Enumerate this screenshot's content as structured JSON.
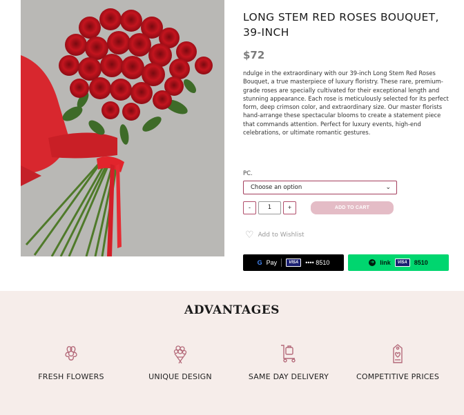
{
  "product": {
    "title": "LONG STEM RED ROSES BOUQUET, 39-INCH",
    "price": "$72",
    "description": "ndulge in the extraordinary with our 39-inch Long Stem Red Roses Bouquet, a true masterpiece of luxury floristry. These rare, premium-grade roses are specially cultivated for their exceptional length and stunning appearance. Each rose is meticulously selected for its perfect form, deep crimson color, and extraordinary size. Our master florists hand-arrange these spectacular blooms to create a statement piece that commands attention.  Perfect for luxury events, high-end celebrations, or ultimate romantic gestures."
  },
  "options": {
    "label": "PC.",
    "select_value": "Choose an option",
    "chevron_icon": "chevron-down-icon"
  },
  "quantity": {
    "minus": "-",
    "value": "1",
    "plus": "+"
  },
  "cart": {
    "add_label": "ADD TO CART"
  },
  "wishlist": {
    "label": "Add to Wishlist",
    "icon": "heart-icon"
  },
  "payment": {
    "gpay_label": "Pay",
    "gpay_card_brand": "VISA",
    "gpay_card_digits": "•••• 8510",
    "link_label": "link",
    "link_card_brand": "VISA",
    "link_card_digits": "8510"
  },
  "advantages": {
    "title": "ADVANTAGES",
    "items": [
      {
        "label": "FRESH FLOWERS",
        "icon": "flower-icon"
      },
      {
        "label": "UNIQUE DESIGN",
        "icon": "bouquet-icon"
      },
      {
        "label": "SAME DAY DELIVERY",
        "icon": "delivery-cart-icon"
      },
      {
        "label": "COMPETITIVE PRICES",
        "icon": "price-tag-icon"
      }
    ]
  },
  "colors": {
    "accent": "#a33c5b",
    "add_to_cart_bg": "#e4bcc6",
    "link_green": "#00d66f",
    "advantages_bg": "#f6edea",
    "icon_color": "#b46a7a"
  }
}
